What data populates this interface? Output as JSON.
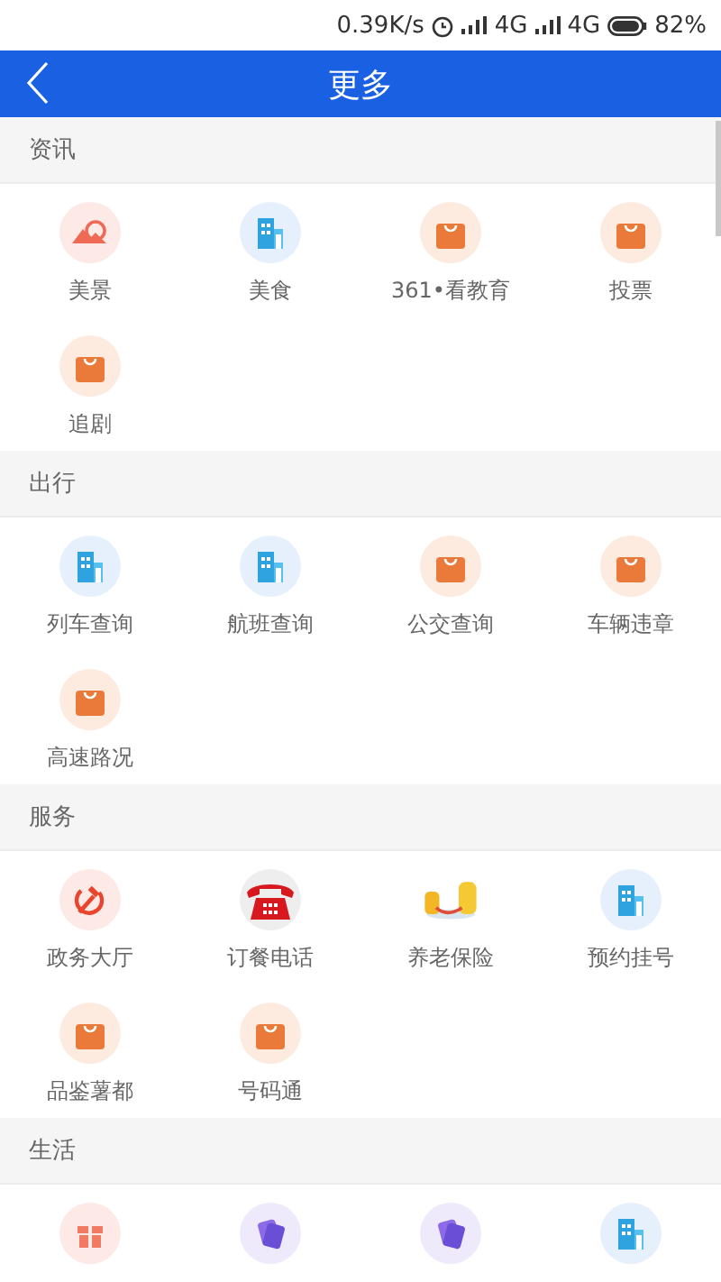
{
  "status_bar": {
    "speed": "0.39K/s",
    "network_1": "4G",
    "network_2": "4G",
    "battery": "82%"
  },
  "header": {
    "title": "更多"
  },
  "sections": [
    {
      "title": "资讯",
      "items": [
        {
          "kind": "landscape",
          "label": "美景"
        },
        {
          "kind": "building",
          "label": "美食"
        },
        {
          "kind": "bag",
          "label": "361•看教育"
        },
        {
          "kind": "bag",
          "label": "投票"
        },
        {
          "kind": "bag",
          "label": "追剧"
        }
      ]
    },
    {
      "title": "出行",
      "items": [
        {
          "kind": "building",
          "label": "列车查询"
        },
        {
          "kind": "building",
          "label": "航班查询"
        },
        {
          "kind": "bag",
          "label": "公交查询"
        },
        {
          "kind": "bag",
          "label": "车辆违章"
        },
        {
          "kind": "bag",
          "label": "高速路况"
        }
      ]
    },
    {
      "title": "服务",
      "items": [
        {
          "kind": "emblem",
          "label": "政务大厅"
        },
        {
          "kind": "phone",
          "label": "订餐电话"
        },
        {
          "kind": "coins",
          "label": "养老保险"
        },
        {
          "kind": "building",
          "label": "预约挂号"
        },
        {
          "kind": "bag",
          "label": "品鉴薯都"
        },
        {
          "kind": "bag",
          "label": "号码通"
        }
      ]
    },
    {
      "title": "生活",
      "items": [
        {
          "kind": "gift"
        },
        {
          "kind": "cards"
        },
        {
          "kind": "cards"
        },
        {
          "kind": "building"
        }
      ]
    }
  ]
}
